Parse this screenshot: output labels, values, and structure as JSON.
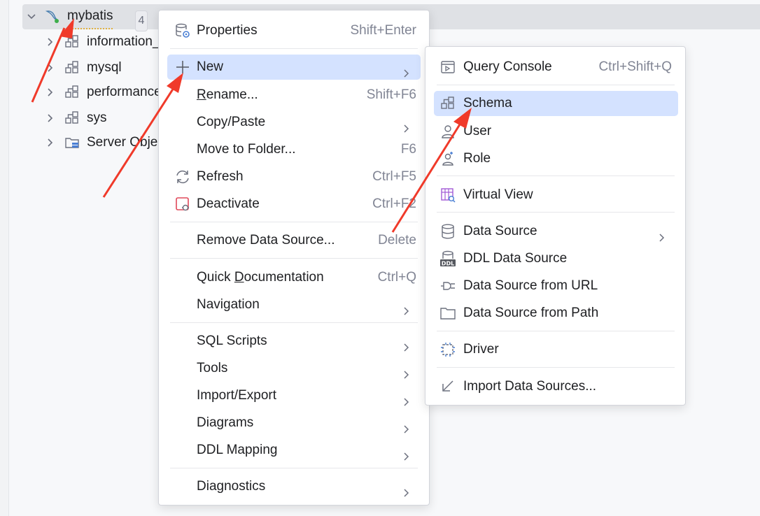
{
  "tree": {
    "root": {
      "label": "mybatis",
      "badge": "4"
    },
    "children": [
      {
        "label": "information_"
      },
      {
        "label": "mysql"
      },
      {
        "label": "performance"
      },
      {
        "label": "sys"
      },
      {
        "label": "Server Obje"
      }
    ]
  },
  "context_menu": {
    "properties": {
      "label": "Properties",
      "shortcut": "Shift+Enter"
    },
    "new": {
      "label": "New"
    },
    "rename": {
      "label_u": "R",
      "label_rest": "ename...",
      "shortcut": "Shift+F6"
    },
    "copy_paste": {
      "label": "Copy/Paste"
    },
    "move_to_folder": {
      "label": "Move to Folder...",
      "shortcut": "F6"
    },
    "refresh": {
      "label": "Refresh",
      "shortcut": "Ctrl+F5"
    },
    "deactivate": {
      "label": "Deactivate",
      "shortcut": "Ctrl+F2"
    },
    "remove_data_source": {
      "label": "Remove Data Source...",
      "shortcut": "Delete"
    },
    "quick_documentation": {
      "label_a": "Quick ",
      "label_u": "D",
      "label_b": "ocumentation",
      "shortcut": "Ctrl+Q"
    },
    "navigation": {
      "label": "Navigation"
    },
    "sql_scripts": {
      "label": "SQL Scripts"
    },
    "tools": {
      "label": "Tools"
    },
    "import_export": {
      "label": "Import/Export"
    },
    "diagrams": {
      "label": "Diagrams"
    },
    "ddl_mapping": {
      "label": "DDL Mapping"
    },
    "diagnostics": {
      "label": "Diagnostics"
    }
  },
  "submenu_new": {
    "query_console": {
      "label": "Query Console",
      "shortcut": "Ctrl+Shift+Q"
    },
    "schema": {
      "label": "Schema"
    },
    "user": {
      "label": "User"
    },
    "role": {
      "label": "Role"
    },
    "virtual_view": {
      "label": "Virtual View"
    },
    "data_source": {
      "label": "Data Source"
    },
    "ddl_data_source": {
      "label": "DDL Data Source",
      "icon_text": "DDL"
    },
    "data_source_from_url": {
      "label": "Data Source from URL"
    },
    "data_source_from_path": {
      "label": "Data Source from Path"
    },
    "driver": {
      "label": "Driver"
    },
    "import_data_sources": {
      "label": "Import Data Sources..."
    }
  },
  "colors": {
    "highlight": "#d4e2ff",
    "selected_row": "#dfe1e5",
    "annotation_arrow": "#f03a2a",
    "icon": "#6c707e"
  }
}
